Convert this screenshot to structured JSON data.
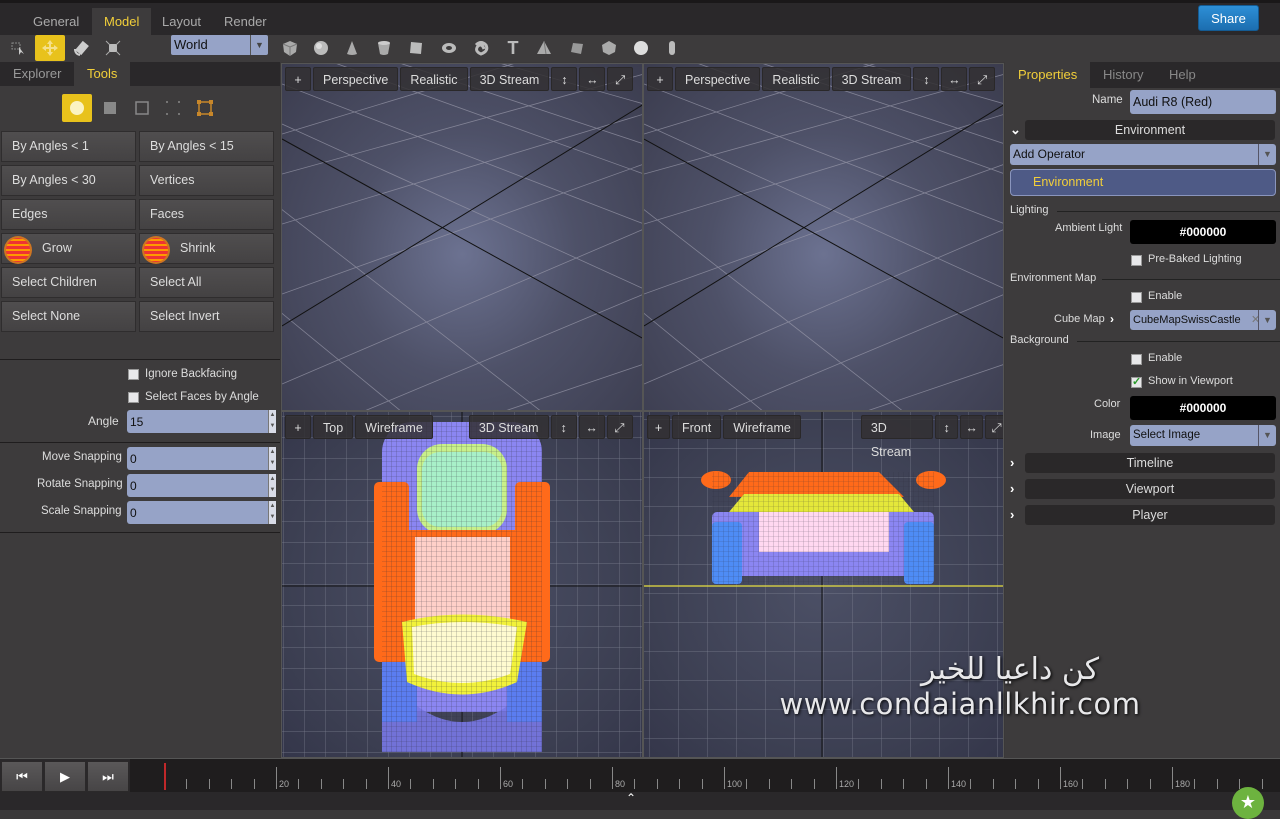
{
  "menu": {
    "tabs": [
      {
        "label": "General",
        "active": false
      },
      {
        "label": "Model",
        "active": true
      },
      {
        "label": "Layout",
        "active": false
      },
      {
        "label": "Render",
        "active": false
      }
    ],
    "share_label": "Share"
  },
  "toolbar": {
    "tools": [
      "select-arrow-icon",
      "move-icon",
      "rotate-icon",
      "scale-icon"
    ],
    "active_tool": "move-icon",
    "coordinate_space": "World",
    "primitives": [
      "cube-icon",
      "sphere-icon",
      "cone-icon",
      "cylinder-icon",
      "plane-icon",
      "torus-icon",
      "knot-icon",
      "text-icon",
      "tetrahedron-icon",
      "octahedron-icon",
      "dodecahedron-icon",
      "icosahedron-icon",
      "capsule-icon"
    ]
  },
  "left_panel": {
    "tabs": [
      {
        "label": "Explorer",
        "active": false
      },
      {
        "label": "Tools",
        "active": true
      }
    ],
    "selection_modes": [
      "object-mode-icon",
      "face-mode-icon",
      "edge-mode-icon",
      "vertex-mode-icon",
      "bounds-mode-icon"
    ],
    "buttons": [
      "By Angles < 1",
      "By Angles < 15",
      "By Angles < 30",
      "Vertices",
      "Edges",
      "Faces",
      "Grow",
      "Shrink",
      "Select Children",
      "Select All",
      "Select None",
      "Select Invert"
    ],
    "ignore_backfacing": {
      "label": "Ignore Backfacing",
      "checked": false
    },
    "select_faces_by_angle": {
      "label": "Select Faces by Angle",
      "checked": false
    },
    "angle": {
      "label": "Angle",
      "value": "15"
    },
    "move_snapping": {
      "label": "Move Snapping",
      "value": "0"
    },
    "rotate_snapping": {
      "label": "Rotate Snapping",
      "value": "0"
    },
    "scale_snapping": {
      "label": "Scale Snapping",
      "value": "0"
    }
  },
  "viewports": [
    {
      "add": "+",
      "view": "Perspective",
      "shading": "Realistic",
      "stream": "3D Stream"
    },
    {
      "add": "+",
      "view": "Perspective",
      "shading": "Realistic",
      "stream": "3D Stream"
    },
    {
      "add": "+",
      "view": "Top",
      "shading": "Wireframe",
      "stream": "3D Stream"
    },
    {
      "add": "+",
      "view": "Front",
      "shading": "Wireframe",
      "stream": "3D Stream"
    }
  ],
  "right_panel": {
    "tabs": [
      {
        "label": "Properties",
        "active": true
      },
      {
        "label": "History",
        "active": false
      },
      {
        "label": "Help",
        "active": false
      }
    ],
    "name_label": "Name",
    "name_value": "Audi R8 (Red)",
    "environment_header": "Environment",
    "add_operator": "Add Operator",
    "operator_item": "Environment",
    "lighting_group": "Lighting",
    "ambient_light_label": "Ambient Light",
    "ambient_light_value": "#000000",
    "prebaked": {
      "label": "Pre-Baked Lighting",
      "checked": false
    },
    "env_map_group": "Environment Map",
    "env_enable": {
      "label": "Enable",
      "checked": false
    },
    "cube_map_label": "Cube Map",
    "cube_map_value": "CubeMapSwissCastle",
    "background_group": "Background",
    "bg_enable": {
      "label": "Enable",
      "checked": false
    },
    "show_in_viewport": {
      "label": "Show in Viewport",
      "checked": true
    },
    "color_label": "Color",
    "color_value": "#000000",
    "image_label": "Image",
    "image_value": "Select Image",
    "sections": [
      "Timeline",
      "Viewport",
      "Player"
    ]
  },
  "timeline": {
    "current_frame": "0",
    "ticks": [
      "20",
      "40",
      "60",
      "80",
      "100",
      "120",
      "140",
      "160",
      "180"
    ]
  },
  "watermark": {
    "arabic": "كن داعيا للخير",
    "url": "www.condaianllkhir.com"
  }
}
